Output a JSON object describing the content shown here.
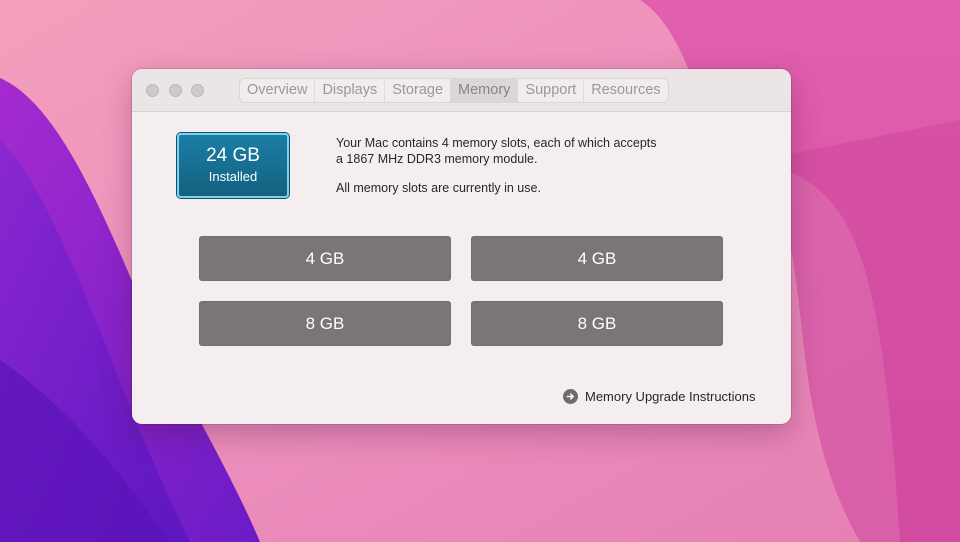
{
  "window": {
    "tabs": [
      {
        "label": "Overview",
        "active": false
      },
      {
        "label": "Displays",
        "active": false
      },
      {
        "label": "Storage",
        "active": false
      },
      {
        "label": "Memory",
        "active": true
      },
      {
        "label": "Support",
        "active": false
      },
      {
        "label": "Resources",
        "active": false
      }
    ]
  },
  "memory": {
    "installed_amount": "24 GB",
    "installed_label": "Installed",
    "description_line1": "Your Mac contains 4 memory slots, each of which accepts",
    "description_line2": "a 1867 MHz DDR3 memory module.",
    "status_text": "All memory slots are currently in use.",
    "slots": [
      "4 GB",
      "4 GB",
      "8 GB",
      "8 GB"
    ],
    "upgrade_link_label": "Memory Upgrade Instructions"
  },
  "icons": {
    "close": "close-icon",
    "minimize": "minimize-icon",
    "zoom": "zoom-icon",
    "upgrade_arrow": "arrow-right-circle-icon"
  },
  "colors": {
    "installed_badge": "#1a7ea6",
    "slot": "#7a7677",
    "window_bg": "#f4eef0",
    "wallpaper_pink": "#ea8cb8",
    "wallpaper_magenta": "#db5aa8",
    "wallpaper_purple": "#7b22c9"
  }
}
